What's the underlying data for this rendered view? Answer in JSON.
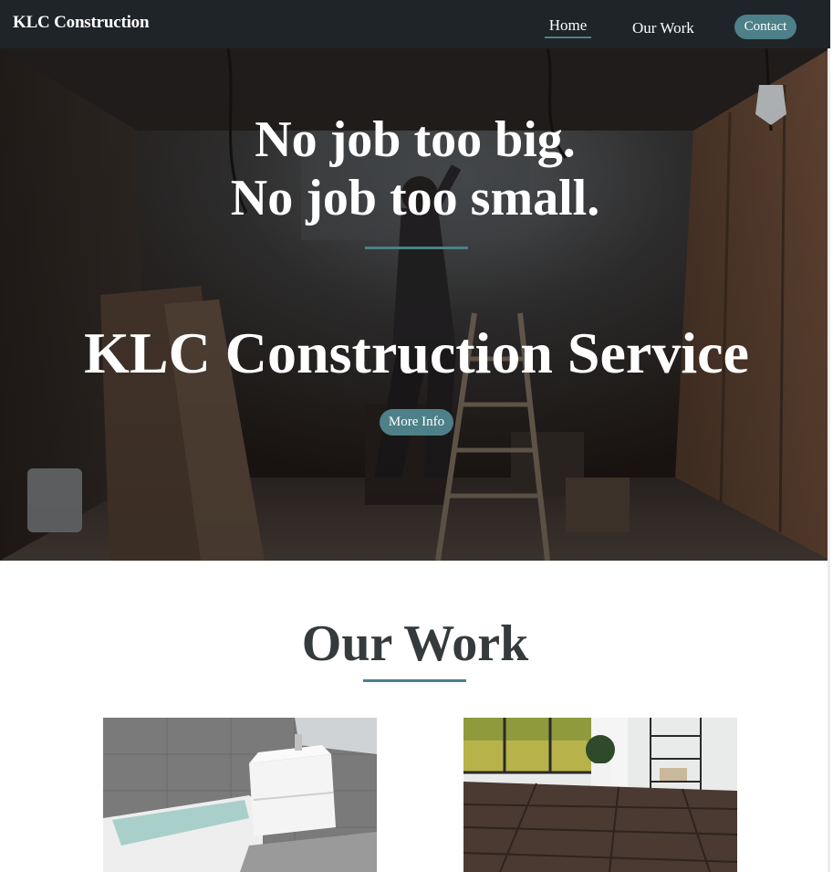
{
  "navbar": {
    "brand": "KLC Construction",
    "links": [
      {
        "label": "Home",
        "active": true
      },
      {
        "label": "Our Work",
        "active": false
      },
      {
        "label": "Contact",
        "active": false
      }
    ]
  },
  "hero": {
    "line1": "No job too big.",
    "line2": "No job too small.",
    "title": "KLC Construction Service",
    "button": "More Info"
  },
  "work": {
    "title": "Our Work"
  },
  "colors": {
    "accent": "#4d8088",
    "navbar_bg": "#1f2428",
    "heading_text": "#353a3d"
  }
}
